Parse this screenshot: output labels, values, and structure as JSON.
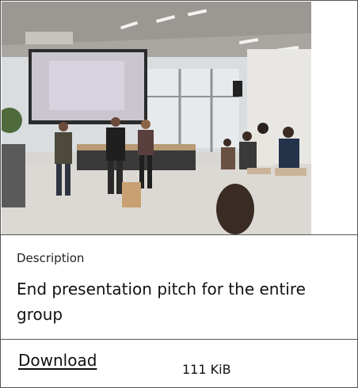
{
  "photo": {
    "subject": "photo of people presenting in front of a projection screen"
  },
  "description": {
    "label": "Description",
    "text": "End presentation pitch for the entire group"
  },
  "download": {
    "link_label": "Download",
    "file_size": "111 KiB"
  },
  "colors": {
    "border": "#555555",
    "text": "#111111",
    "background": "#ffffff"
  }
}
